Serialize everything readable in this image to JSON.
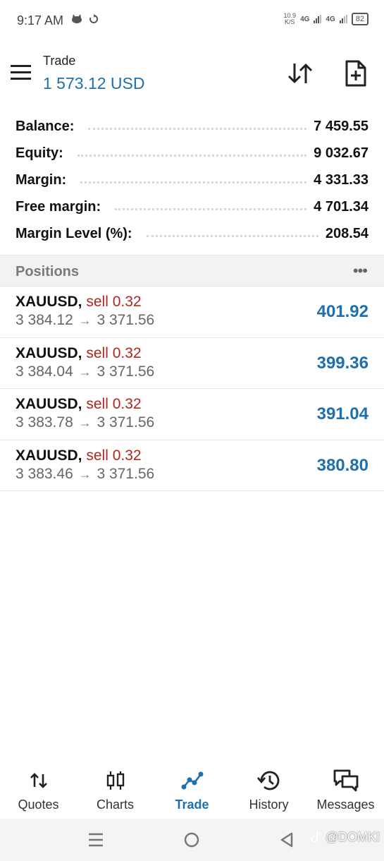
{
  "status_bar": {
    "time": "9:17 AM",
    "net_speed_value": "10.9",
    "net_speed_unit": "K/S",
    "signal1": "4G",
    "signal2": "4G",
    "battery": "82"
  },
  "header": {
    "title": "Trade",
    "amount": "1 573.12 USD"
  },
  "summary": [
    {
      "label": "Balance:",
      "value": "7 459.55"
    },
    {
      "label": "Equity:",
      "value": "9 032.67"
    },
    {
      "label": "Margin:",
      "value": "4 331.33"
    },
    {
      "label": "Free margin:",
      "value": "4 701.34"
    },
    {
      "label": "Margin Level (%):",
      "value": "208.54"
    }
  ],
  "positions": {
    "title": "Positions",
    "more_icon": "more-horizontal-icon",
    "items": [
      {
        "symbol": "XAUUSD,",
        "side": "sell 0.32",
        "open": "3 384.12",
        "arrow": "→",
        "current": "3 371.56",
        "profit": "401.92"
      },
      {
        "symbol": "XAUUSD,",
        "side": "sell 0.32",
        "open": "3 384.04",
        "arrow": "→",
        "current": "3 371.56",
        "profit": "399.36"
      },
      {
        "symbol": "XAUUSD,",
        "side": "sell 0.32",
        "open": "3 383.78",
        "arrow": "→",
        "current": "3 371.56",
        "profit": "391.04"
      },
      {
        "symbol": "XAUUSD,",
        "side": "sell 0.32",
        "open": "3 383.46",
        "arrow": "→",
        "current": "3 371.56",
        "profit": "380.80"
      }
    ]
  },
  "bottom_nav": [
    {
      "label": "Quotes",
      "icon": "quotes-icon"
    },
    {
      "label": "Charts",
      "icon": "charts-icon"
    },
    {
      "label": "Trade",
      "icon": "trade-icon",
      "active": true
    },
    {
      "label": "History",
      "icon": "history-icon"
    },
    {
      "label": "Messages",
      "icon": "messages-icon"
    }
  ],
  "watermark": "@DOMKI",
  "colors": {
    "accent_blue": "#1e6fb0",
    "sell_red": "#b3261e"
  }
}
